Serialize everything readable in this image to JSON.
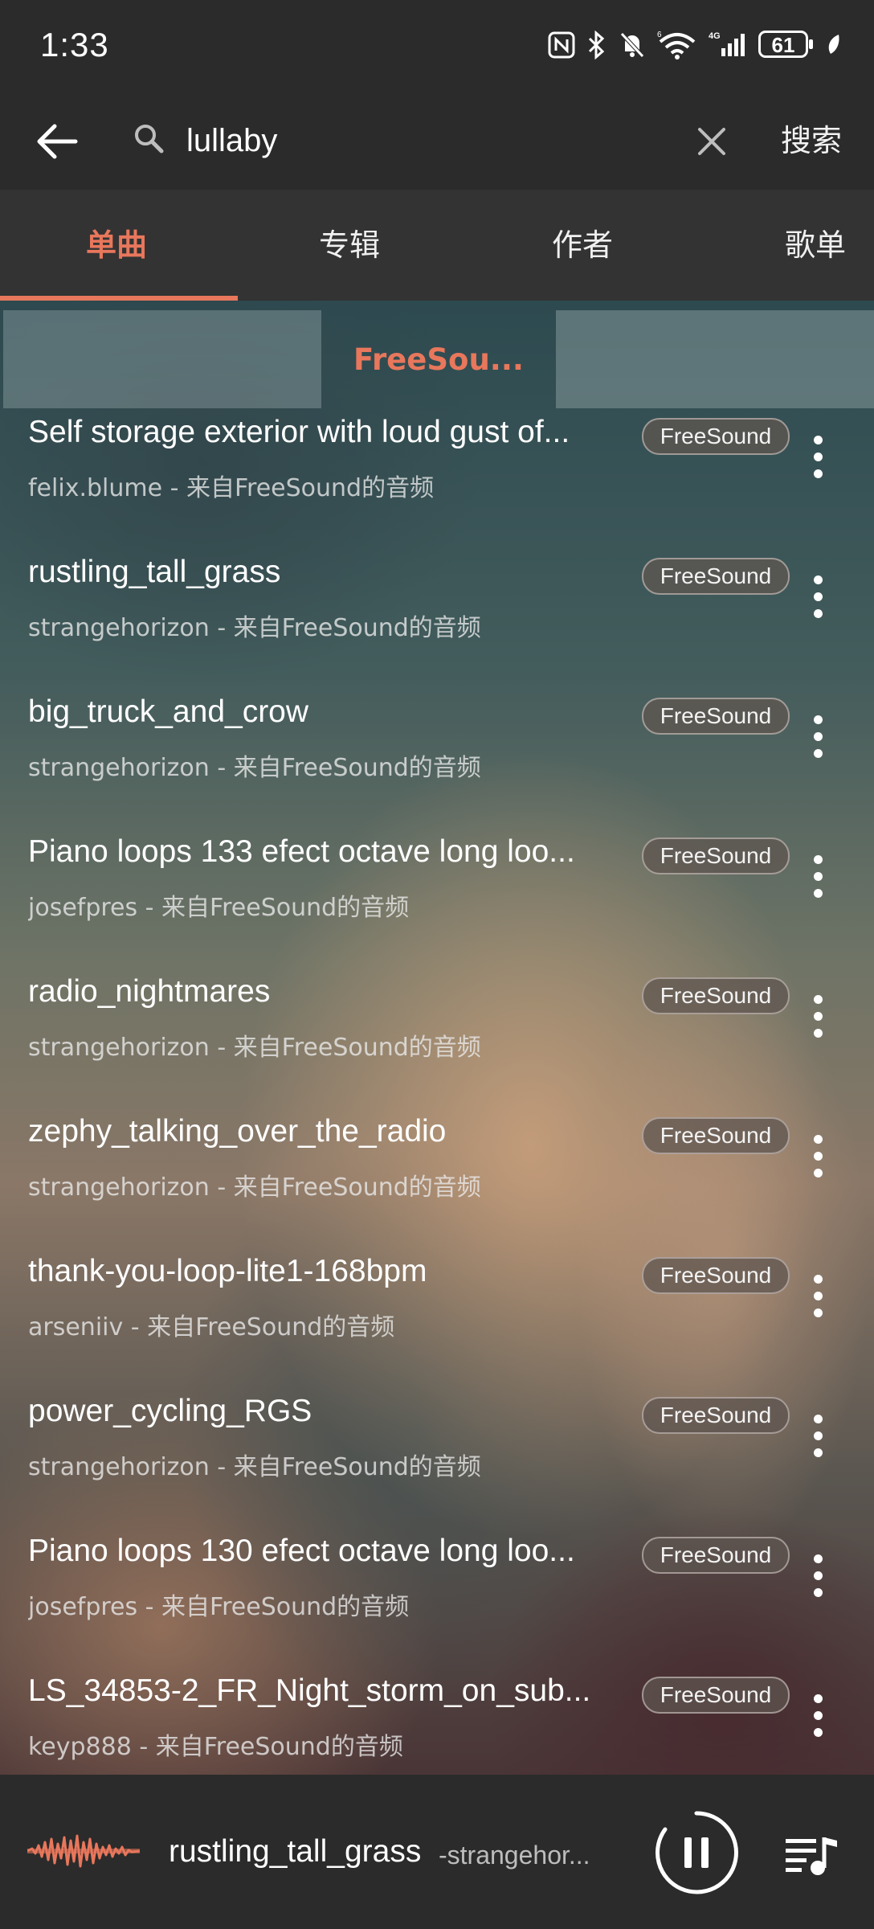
{
  "status_bar": {
    "time": "1:33",
    "battery": "61"
  },
  "search": {
    "query": "lullaby",
    "submit_label": "搜索"
  },
  "tabs": [
    {
      "label": "单曲",
      "active": true
    },
    {
      "label": "专辑",
      "active": false
    },
    {
      "label": "作者",
      "active": false
    },
    {
      "label": "歌单",
      "active": false
    }
  ],
  "source_filter": {
    "active_label": "FreeSou..."
  },
  "songs": [
    {
      "title": "Self storage exterior with loud gust of...",
      "subtitle": "felix.blume - 来自FreeSound的音频",
      "source": "FreeSound"
    },
    {
      "title": "rustling_tall_grass",
      "subtitle": "strangehorizon - 来自FreeSound的音频",
      "source": "FreeSound"
    },
    {
      "title": "big_truck_and_crow",
      "subtitle": "strangehorizon - 来自FreeSound的音频",
      "source": "FreeSound"
    },
    {
      "title": "Piano loops 133 efect octave long loo...",
      "subtitle": "josefpres - 来自FreeSound的音频",
      "source": "FreeSound"
    },
    {
      "title": "radio_nightmares",
      "subtitle": "strangehorizon - 来自FreeSound的音频",
      "source": "FreeSound"
    },
    {
      "title": "zephy_talking_over_the_radio",
      "subtitle": "strangehorizon - 来自FreeSound的音频",
      "source": "FreeSound"
    },
    {
      "title": "thank-you-loop-lite1-168bpm",
      "subtitle": "arseniiv - 来自FreeSound的音频",
      "source": "FreeSound"
    },
    {
      "title": "power_cycling_RGS",
      "subtitle": "strangehorizon - 来自FreeSound的音频",
      "source": "FreeSound"
    },
    {
      "title": "Piano loops 130 efect octave long loo...",
      "subtitle": "josefpres - 来自FreeSound的音频",
      "source": "FreeSound"
    },
    {
      "title": "LS_34853-2_FR_Night_storm_on_sub...",
      "subtitle": "keyp888 - 来自FreeSound的音频",
      "source": "FreeSound"
    }
  ],
  "now_playing": {
    "title": "rustling_tall_grass",
    "artist": "-strangehor..."
  },
  "colors": {
    "accent": "#e8775c",
    "bar_bg": "#2b2b2b",
    "tabs_bg": "#333333"
  }
}
